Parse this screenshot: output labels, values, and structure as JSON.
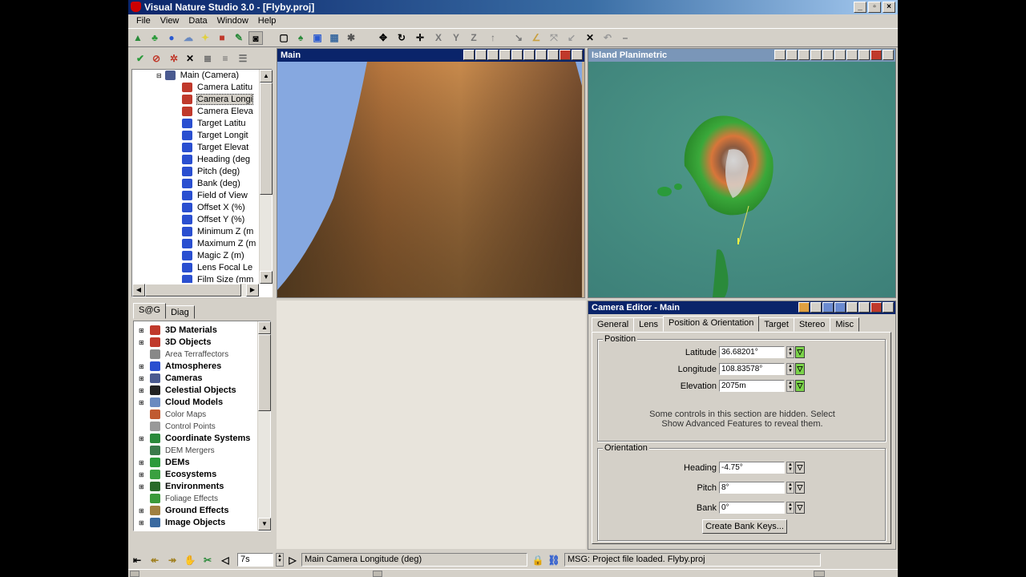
{
  "app": {
    "title": "Visual Nature Studio 3.0  - [Flyby.proj]"
  },
  "menu": [
    "File",
    "View",
    "Data",
    "Window",
    "Help"
  ],
  "toolbar": {
    "axis_labels": [
      "X",
      "Y",
      "Z"
    ]
  },
  "camera_tree": {
    "root": "Main (Camera)",
    "items": [
      "Camera Latitu",
      "Camera Longi",
      "Camera Eleva",
      "Target Latitu",
      "Target Longit",
      "Target Elevat",
      "Heading (deg",
      "Pitch (deg)",
      "Bank (deg)",
      "Field of View",
      "Offset X (%)",
      "Offset Y (%)",
      "Minimum Z (m",
      "Maximum Z (m",
      "Magic Z (m)",
      "Lens Focal Le",
      "Film Size (mm"
    ],
    "selected_index": 1
  },
  "sg_panel": {
    "tabs": [
      "S@G",
      "Diag"
    ],
    "items": [
      {
        "label": "3D Materials",
        "bold": true,
        "icon_color": "#c0392b"
      },
      {
        "label": "3D Objects",
        "bold": true,
        "icon_color": "#c0392b"
      },
      {
        "label": "Area Terraffectors",
        "bold": false,
        "icon_color": "#888888"
      },
      {
        "label": "Atmospheres",
        "bold": true,
        "icon_color": "#2a4fd0"
      },
      {
        "label": "Cameras",
        "bold": true,
        "icon_color": "#4a5a90"
      },
      {
        "label": "Celestial Objects",
        "bold": true,
        "icon_color": "#222222"
      },
      {
        "label": "Cloud Models",
        "bold": true,
        "icon_color": "#6a8ac0"
      },
      {
        "label": "Color Maps",
        "bold": false,
        "icon_color": "#c05a30"
      },
      {
        "label": "Control Points",
        "bold": false,
        "icon_color": "#999999"
      },
      {
        "label": "Coordinate Systems",
        "bold": true,
        "icon_color": "#2a8a3a"
      },
      {
        "label": "DEM Mergers",
        "bold": false,
        "icon_color": "#3a7a4a"
      },
      {
        "label": "DEMs",
        "bold": true,
        "icon_color": "#2a9a3a"
      },
      {
        "label": "Ecosystems",
        "bold": true,
        "icon_color": "#3aa040"
      },
      {
        "label": "Environments",
        "bold": true,
        "icon_color": "#2a6a2a"
      },
      {
        "label": "Foliage Effects",
        "bold": false,
        "icon_color": "#3a9a3a"
      },
      {
        "label": "Ground Effects",
        "bold": true,
        "icon_color": "#a08040"
      },
      {
        "label": "Image Objects",
        "bold": true,
        "icon_color": "#3a6aa0"
      }
    ]
  },
  "views": {
    "main": {
      "title": "Main"
    },
    "planimetric": {
      "title": "Island Planimetric"
    }
  },
  "camera_editor": {
    "title": "Camera Editor - Main",
    "tabs": [
      "General",
      "Lens",
      "Position & Orientation",
      "Target",
      "Stereo",
      "Misc"
    ],
    "active_tab": "Position & Orientation",
    "position": {
      "group_label": "Position",
      "fields": [
        {
          "label": "Latitude",
          "value": "36.68201°",
          "key_color": "green"
        },
        {
          "label": "Longitude",
          "value": "108.83578°",
          "key_color": "green"
        },
        {
          "label": "Elevation",
          "value": "2075m",
          "key_color": "green"
        }
      ],
      "hidden_note_line1": "Some controls in this section are hidden. Select",
      "hidden_note_line2": "Show Advanced Features to reveal them."
    },
    "orientation": {
      "group_label": "Orientation",
      "fields": [
        {
          "label": "Heading",
          "value": "-4.75°",
          "key_color": "gray"
        },
        {
          "label": "Pitch",
          "value": "8°",
          "key_color": "gray"
        },
        {
          "label": "Bank",
          "value": "0°",
          "key_color": "gray"
        }
      ],
      "bank_keys_button": "Create Bank Keys..."
    }
  },
  "status": {
    "time": "7s",
    "parameter": "Main Camera Longitude (deg)",
    "message": "MSG: Project file loaded. Flyby.proj"
  }
}
